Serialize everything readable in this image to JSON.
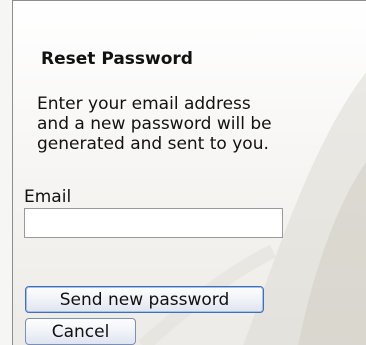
{
  "form": {
    "title": "Reset Password",
    "description": "Enter your email address\nand a new password will be\ngenerated and sent to you.",
    "email_label": "Email",
    "email_value": "",
    "send_label": "Send new password",
    "cancel_label": "Cancel"
  }
}
